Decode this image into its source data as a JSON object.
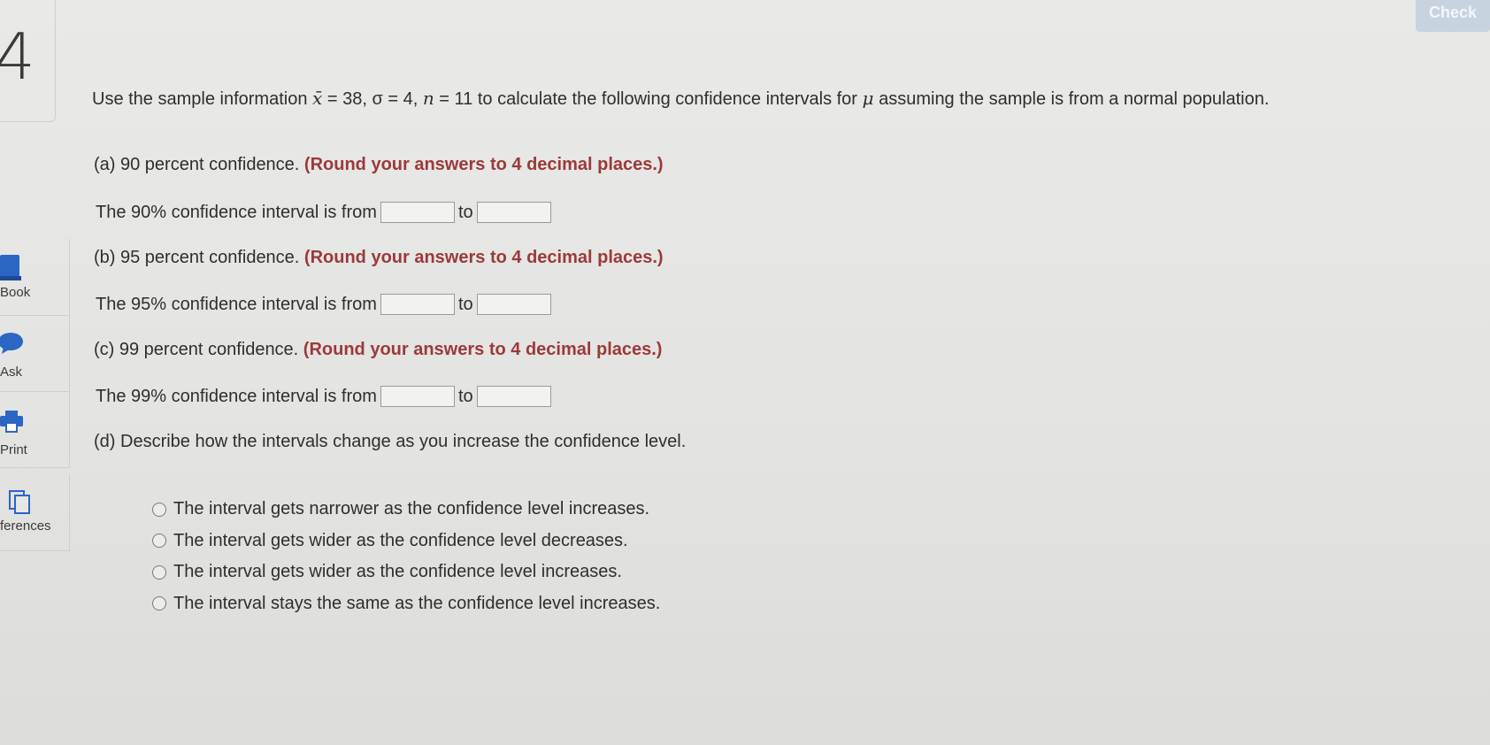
{
  "question_number": "4",
  "check_label": "Check",
  "sidebar": {
    "items": [
      {
        "label": "Book",
        "icon": "book-icon"
      },
      {
        "label": "Ask",
        "icon": "chat-bubble-icon"
      },
      {
        "label": "Print",
        "icon": "printer-icon"
      },
      {
        "label": "ferences",
        "icon": "copy-icon"
      }
    ]
  },
  "question": {
    "intro_prefix": "Use the sample information ",
    "xbar": "x̄",
    "intro_vals": " = 38, σ = 4, ",
    "n": "n",
    "intro_rest": " = 11 to calculate the following confidence intervals for ",
    "mu": "μ",
    "intro_end": " assuming the sample is from a normal population.",
    "parts": [
      {
        "label": "(a) 90 percent confidence. ",
        "round": "(Round your answers to 4 decimal places.)",
        "interval_text": "The 90% confidence interval is from",
        "to": "to"
      },
      {
        "label": "(b) 95 percent confidence. ",
        "round": "(Round your answers to 4 decimal places.)",
        "interval_text": "The 95% confidence interval is from",
        "to": "to"
      },
      {
        "label": "(c) 99 percent confidence. ",
        "round": "(Round your answers to 4 decimal places.)",
        "interval_text": "The 99% confidence interval is from",
        "to": "to"
      }
    ],
    "part_d": "(d) Describe how the intervals change as you increase the confidence level.",
    "options": [
      "The interval gets narrower as the confidence level increases.",
      "The interval gets wider as the confidence level decreases.",
      "The interval gets wider as the confidence level increases.",
      "The interval stays the same as the confidence level increases."
    ]
  }
}
